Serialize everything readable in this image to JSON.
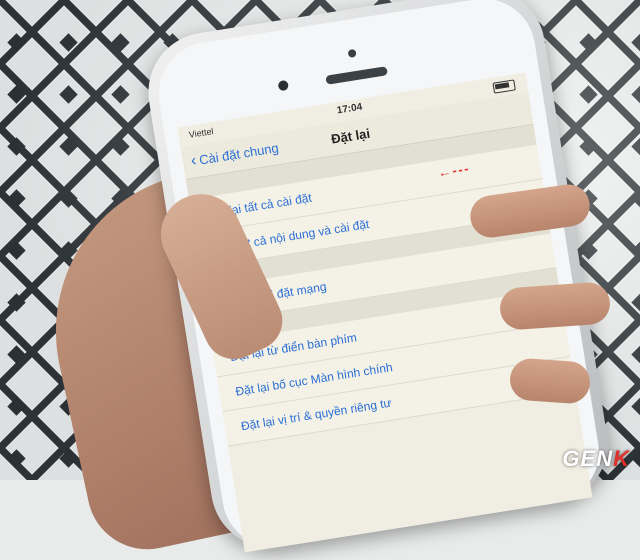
{
  "status_bar": {
    "carrier": "Viettel",
    "time": "17:04"
  },
  "nav": {
    "back_label": "Cài đặt chung",
    "title": "Đặt lại"
  },
  "reset_options": [
    {
      "label": "Đặt lại tất cả cài đặt"
    },
    {
      "label": "Xóa tất cả nội dung và cài đặt"
    },
    {
      "label": "Đặt lại cài đặt mạng"
    },
    {
      "label": "Đặt lại từ điển bàn phím"
    },
    {
      "label": "Đặt lại bố cục Màn hình chính"
    },
    {
      "label": "Đặt lại vị trí & quyền riêng tư"
    }
  ],
  "annotation_arrow": "← - - -",
  "watermark": {
    "text_main": "GEN",
    "text_accent": "K"
  },
  "colors": {
    "link": "#2a6fd6",
    "arrow": "#e0322a",
    "screen_bg": "#f0ede2"
  }
}
